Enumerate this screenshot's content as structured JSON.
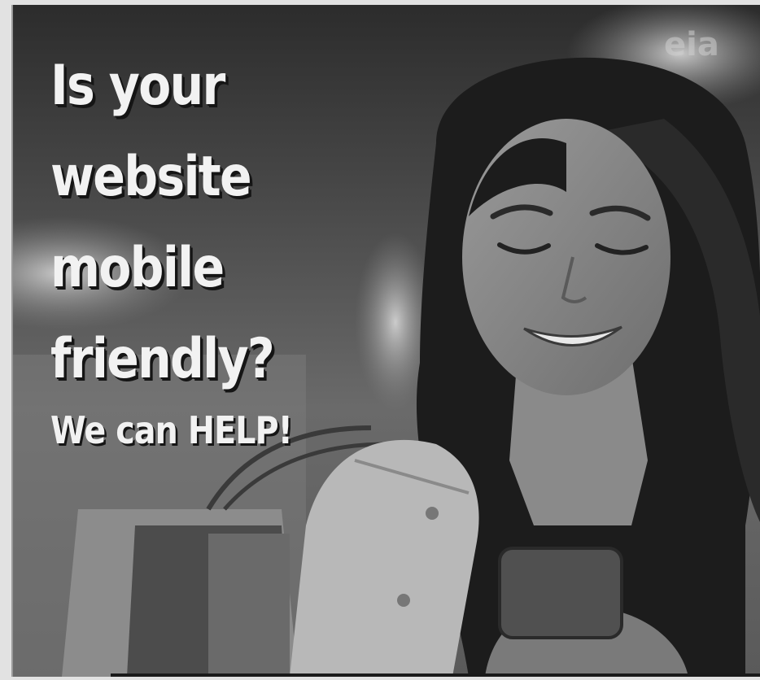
{
  "ad": {
    "headline": [
      "Is your",
      "website",
      "mobile",
      "friendly?"
    ],
    "subline": "We can HELP!"
  },
  "background": {
    "storefront_sign_fragment": "eia"
  }
}
